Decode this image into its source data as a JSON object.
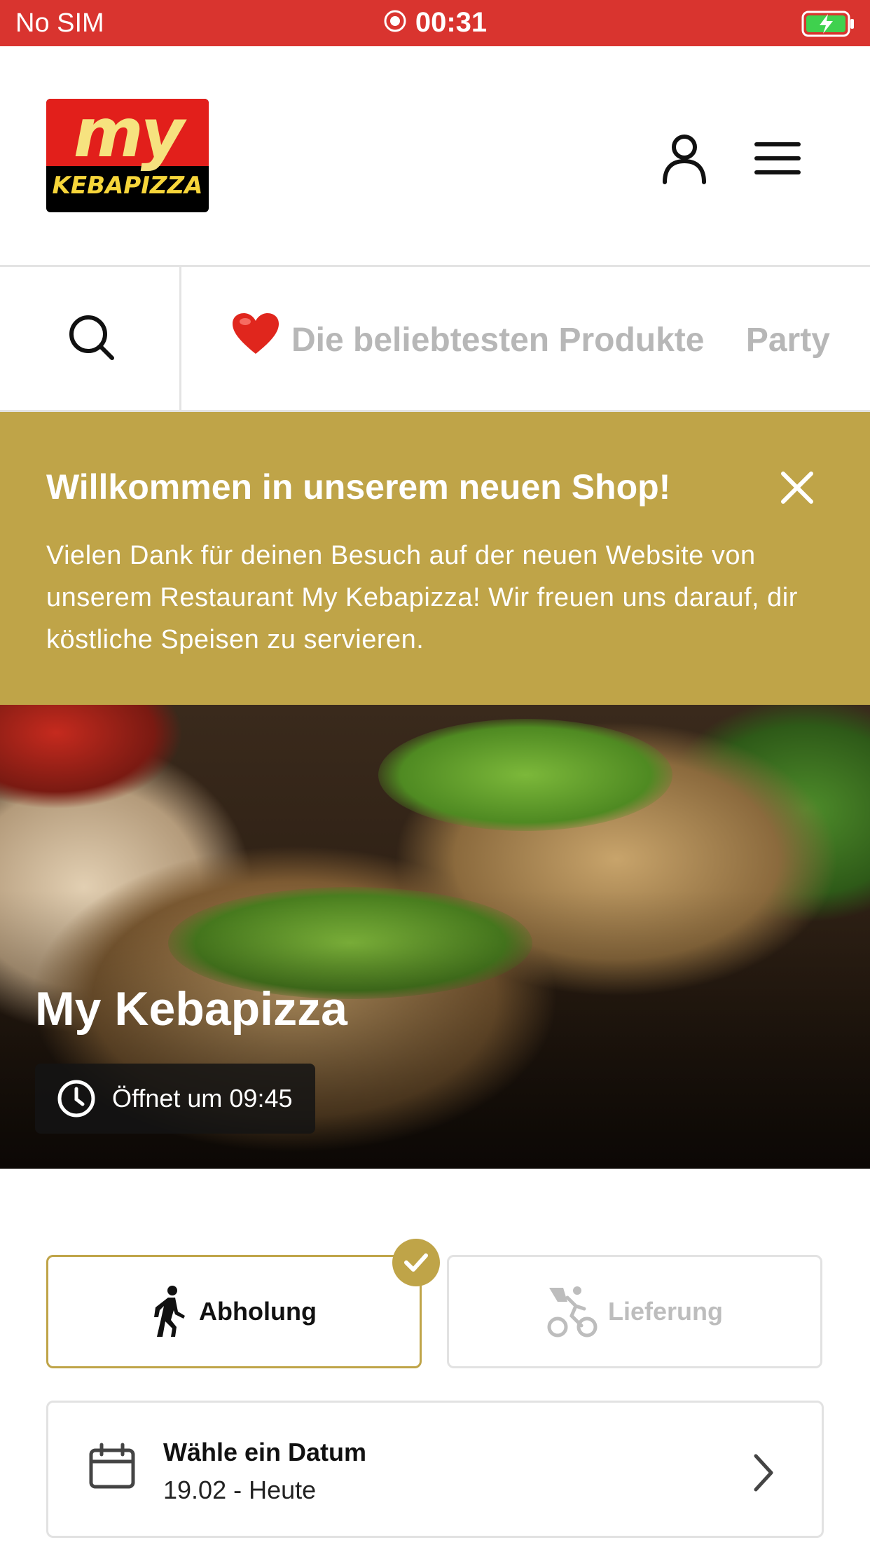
{
  "status_bar": {
    "carrier": "No SIM",
    "time": "00:31",
    "battery_icon": "battery-charging-icon",
    "record_icon": "screen-record-icon"
  },
  "header": {
    "logo_top": "my",
    "logo_bottom": "KEBAPIZZA",
    "account_icon": "user-icon",
    "menu_icon": "hamburger-menu-icon"
  },
  "category_nav": {
    "search_icon": "search-icon",
    "tabs": [
      {
        "label": "Die beliebtesten Produkte",
        "icon": "heart-icon"
      },
      {
        "label": "Party"
      }
    ]
  },
  "welcome": {
    "title": "Willkommen in unserem neuen Shop!",
    "text": "Vielen Dank für deinen Besuch auf der neuen Website von unserem Restaurant My Kebapizza! Wir freuen uns darauf, dir köstliche Speisen zu servieren."
  },
  "hero": {
    "restaurant_name": "My Kebapizza",
    "opening_text": "Öffnet um 09:45"
  },
  "order_mode": {
    "pickup_label": "Abholung",
    "delivery_label": "Lieferung",
    "selected": "pickup"
  },
  "date_picker": {
    "label": "Wähle ein Datum",
    "value": "19.02 - Heute"
  },
  "colors": {
    "status_bar": "#d9342f",
    "accent_gold": "#bfa448"
  }
}
